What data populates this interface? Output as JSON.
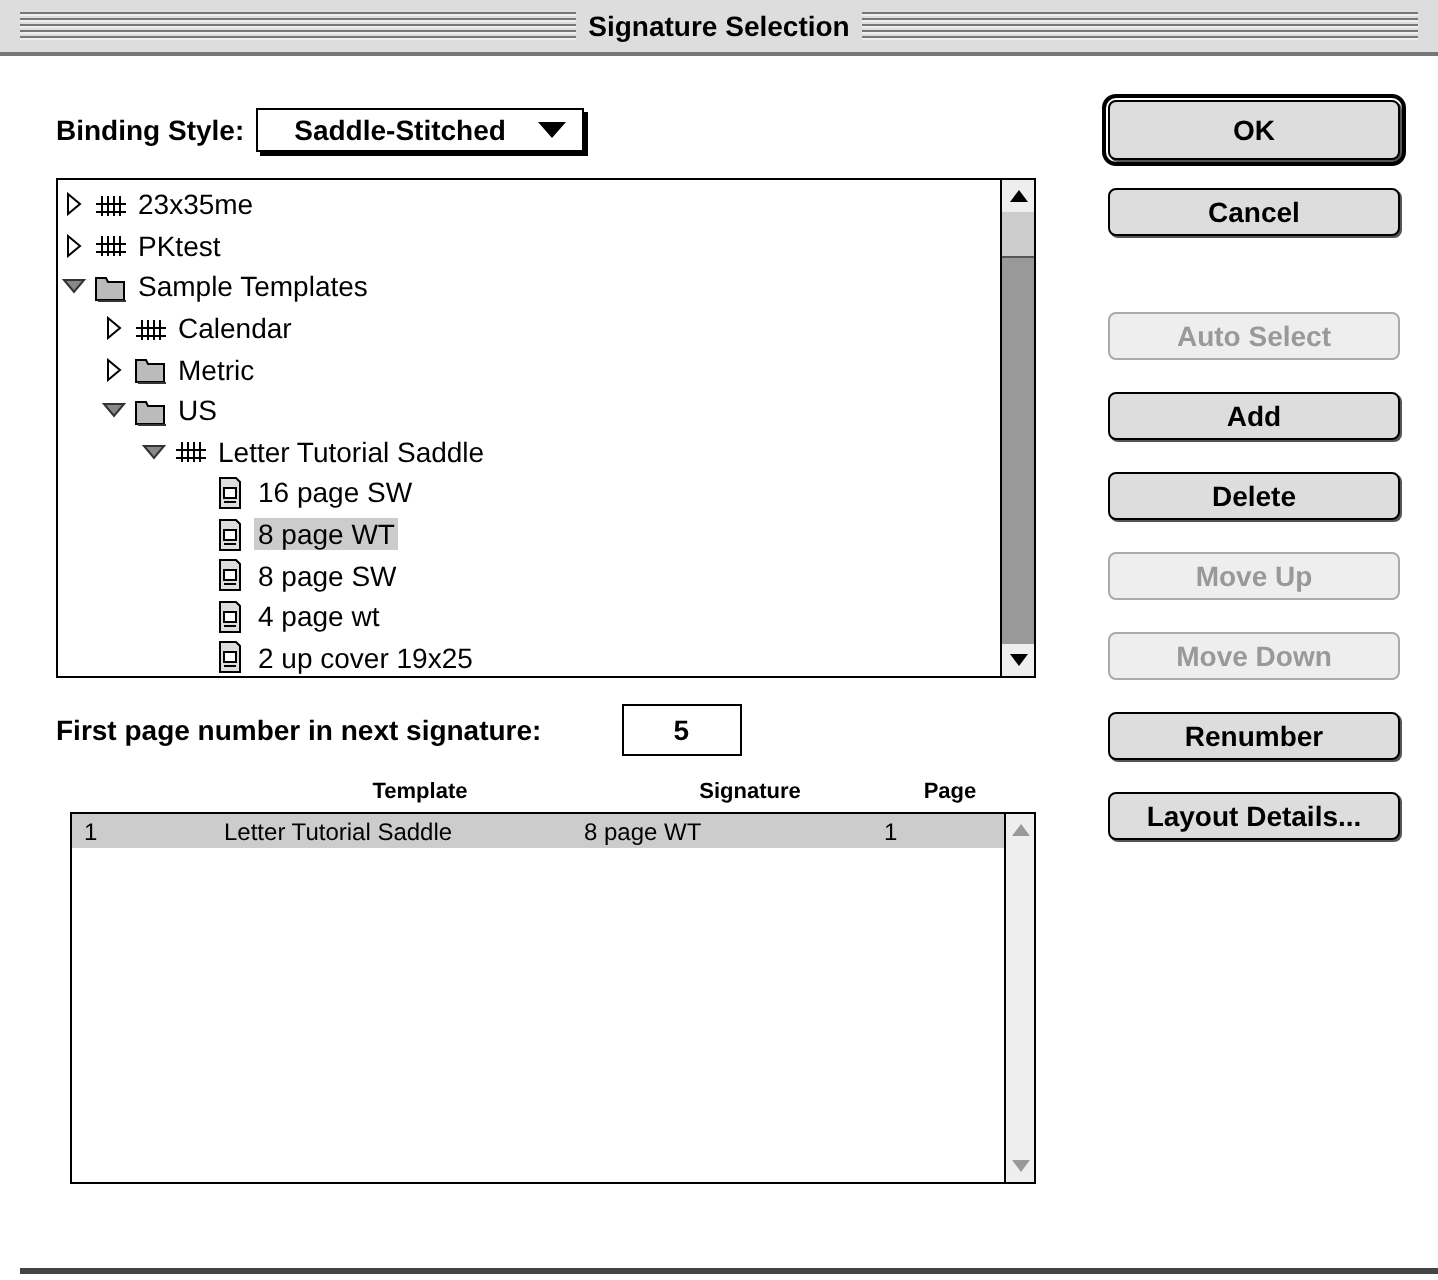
{
  "window": {
    "title": "Signature Selection"
  },
  "binding_style": {
    "label": "Binding Style:",
    "value": "Saddle-Stitched"
  },
  "tree": [
    {
      "label": "23x35me",
      "kind": "template",
      "expanded": false,
      "selected": false
    },
    {
      "label": "PKtest",
      "kind": "template",
      "expanded": false,
      "selected": false
    },
    {
      "label": "Sample Templates",
      "kind": "folder",
      "expanded": true,
      "selected": false,
      "children": [
        {
          "label": "Calendar",
          "kind": "template",
          "expanded": false,
          "selected": false
        },
        {
          "label": "Metric",
          "kind": "folder",
          "expanded": false,
          "selected": false
        },
        {
          "label": "US",
          "kind": "folder",
          "expanded": true,
          "selected": false,
          "children": [
            {
              "label": "Letter Tutorial Saddle",
              "kind": "template",
              "expanded": true,
              "selected": false,
              "children": [
                {
                  "label": "16 page SW",
                  "kind": "signature",
                  "selected": false
                },
                {
                  "label": "8 page WT",
                  "kind": "signature",
                  "selected": true
                },
                {
                  "label": "8 page SW",
                  "kind": "signature",
                  "selected": false
                },
                {
                  "label": "4 page wt",
                  "kind": "signature",
                  "selected": false
                },
                {
                  "label": "2 up cover 19x25",
                  "kind": "signature",
                  "selected": false
                }
              ]
            }
          ]
        }
      ]
    }
  ],
  "first_page": {
    "label": "First page number in next signature:",
    "value": "5"
  },
  "table": {
    "columns": [
      "Template",
      "Signature",
      "Page"
    ],
    "rows": [
      {
        "number": "1",
        "template": "Letter Tutorial Saddle",
        "signature": "8 page WT",
        "page": "1",
        "selected": true
      }
    ]
  },
  "dialog_buttons": [
    {
      "label": "OK",
      "default": true,
      "disabled": false
    },
    {
      "label": "Cancel",
      "default": false,
      "disabled": false
    }
  ],
  "action_buttons": [
    {
      "label": "Auto Select",
      "disabled": true
    },
    {
      "label": "Add",
      "disabled": false
    },
    {
      "label": "Delete",
      "disabled": false
    },
    {
      "label": "Move Up",
      "disabled": true
    },
    {
      "label": "Move Down",
      "disabled": true
    },
    {
      "label": "Renumber",
      "disabled": false
    },
    {
      "label": "Layout Details...",
      "disabled": false
    }
  ]
}
